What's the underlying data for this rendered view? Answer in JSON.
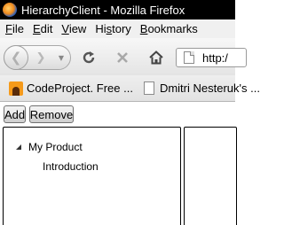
{
  "window": {
    "title": "HierarchyClient - Mozilla Firefox",
    "icon": "firefox-icon"
  },
  "menu": {
    "items": [
      {
        "accel": "F",
        "rest": "ile"
      },
      {
        "accel": "E",
        "rest": "dit"
      },
      {
        "accel": "V",
        "rest": "iew"
      },
      {
        "pre": "Hi",
        "accel": "s",
        "rest": "tory"
      },
      {
        "accel": "B",
        "rest": "ookmarks"
      }
    ]
  },
  "nav": {
    "back_icon": "back-arrow-icon",
    "forward_icon": "forward-arrow-icon",
    "history_icon": "chevron-down-icon",
    "reload_icon": "reload-icon",
    "stop_icon": "stop-icon",
    "home_icon": "home-icon",
    "url": "http:/"
  },
  "bookmarks": {
    "items": [
      {
        "label": "CodeProject. Free ...",
        "icon": "codeproject-icon"
      },
      {
        "label": "Dmitri Nesteruk's ...",
        "icon": "page-icon"
      }
    ]
  },
  "toolbar": {
    "add_label": "Add",
    "remove_label": "Remove"
  },
  "tree": {
    "root": {
      "label": "My Product",
      "expanded": true
    },
    "children": [
      {
        "label": "Introduction"
      }
    ]
  },
  "colors": {
    "titlebar": "#000000",
    "border": "#000000",
    "expander": "#333333"
  }
}
